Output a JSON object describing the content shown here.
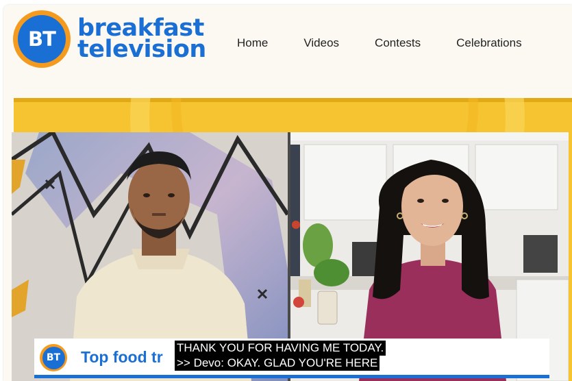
{
  "brand": {
    "logo_initials": "BT",
    "name_line1": "breakfast",
    "name_line2": "television"
  },
  "nav": {
    "items": [
      {
        "label": "Home"
      },
      {
        "label": "Videos"
      },
      {
        "label": "Contests"
      },
      {
        "label": "Celebrations"
      }
    ]
  },
  "video": {
    "lower_third": {
      "logo_initials": "BT",
      "title": "Top food tr"
    },
    "captions": [
      "THANK YOU FOR HAVING ME TODAY.",
      ">> Devo: OKAY. GLAD YOU'RE HERE"
    ]
  },
  "colors": {
    "brand_blue": "#1a6fd4",
    "brand_orange": "#f39a1f",
    "hero_yellow": "#f6c331"
  }
}
